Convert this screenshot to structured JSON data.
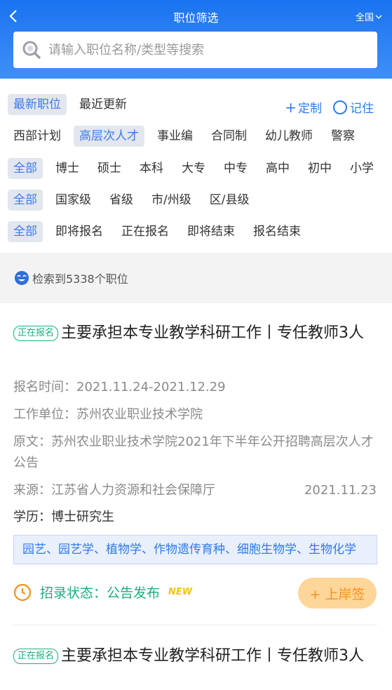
{
  "header": {
    "title": "职位筛选",
    "region": "全国",
    "search_placeholder": "请输入职位名称/类型等搜索"
  },
  "sort": {
    "tabs": [
      "最新职位",
      "最近更新"
    ],
    "customize": "定制",
    "remember": "记住"
  },
  "filters": {
    "category": [
      "西部计划",
      "高层次人才",
      "事业编",
      "合同制",
      "幼儿教师",
      "警察"
    ],
    "education": [
      "全部",
      "博士",
      "硕士",
      "本科",
      "大专",
      "中专",
      "高中",
      "初中",
      "小学"
    ],
    "level": [
      "全部",
      "国家级",
      "省级",
      "市/州级",
      "区/县级"
    ],
    "status": [
      "全部",
      "即将报名",
      "正在报名",
      "即将结束",
      "报名结束"
    ]
  },
  "result_count": "检索到5338个职位",
  "jobs": [
    {
      "badge": "正在报名",
      "title": "主要承担本专业教学科研工作丨专任教师3人",
      "signup_time": "报名时间：2021.11.24-2021.12.29",
      "employer": "工作单位：苏州农业职业技术学院",
      "source_text": "原文：苏州农业职业技术学院2021年下半年公开招聘高层次人才公告",
      "source": "来源：江苏省人力资源和社会保障厅",
      "date": "2021.11.23",
      "education": "学历：博士研究生",
      "majors": "园艺、园艺学、植物学、作物遗传育种、细胞生物学、生物化学",
      "status": "招录状态：公告发布",
      "new_tag": "NEW",
      "add_button": "+ 上岸签"
    },
    {
      "badge": "正在报名",
      "title": "主要承担本专业教学科研工作丨专任教师3人"
    }
  ],
  "colors": {
    "header_blue": "#1a73f0",
    "accent_blue": "#2f7bf0",
    "green": "#1bb07b",
    "orange": "#f1921f"
  }
}
